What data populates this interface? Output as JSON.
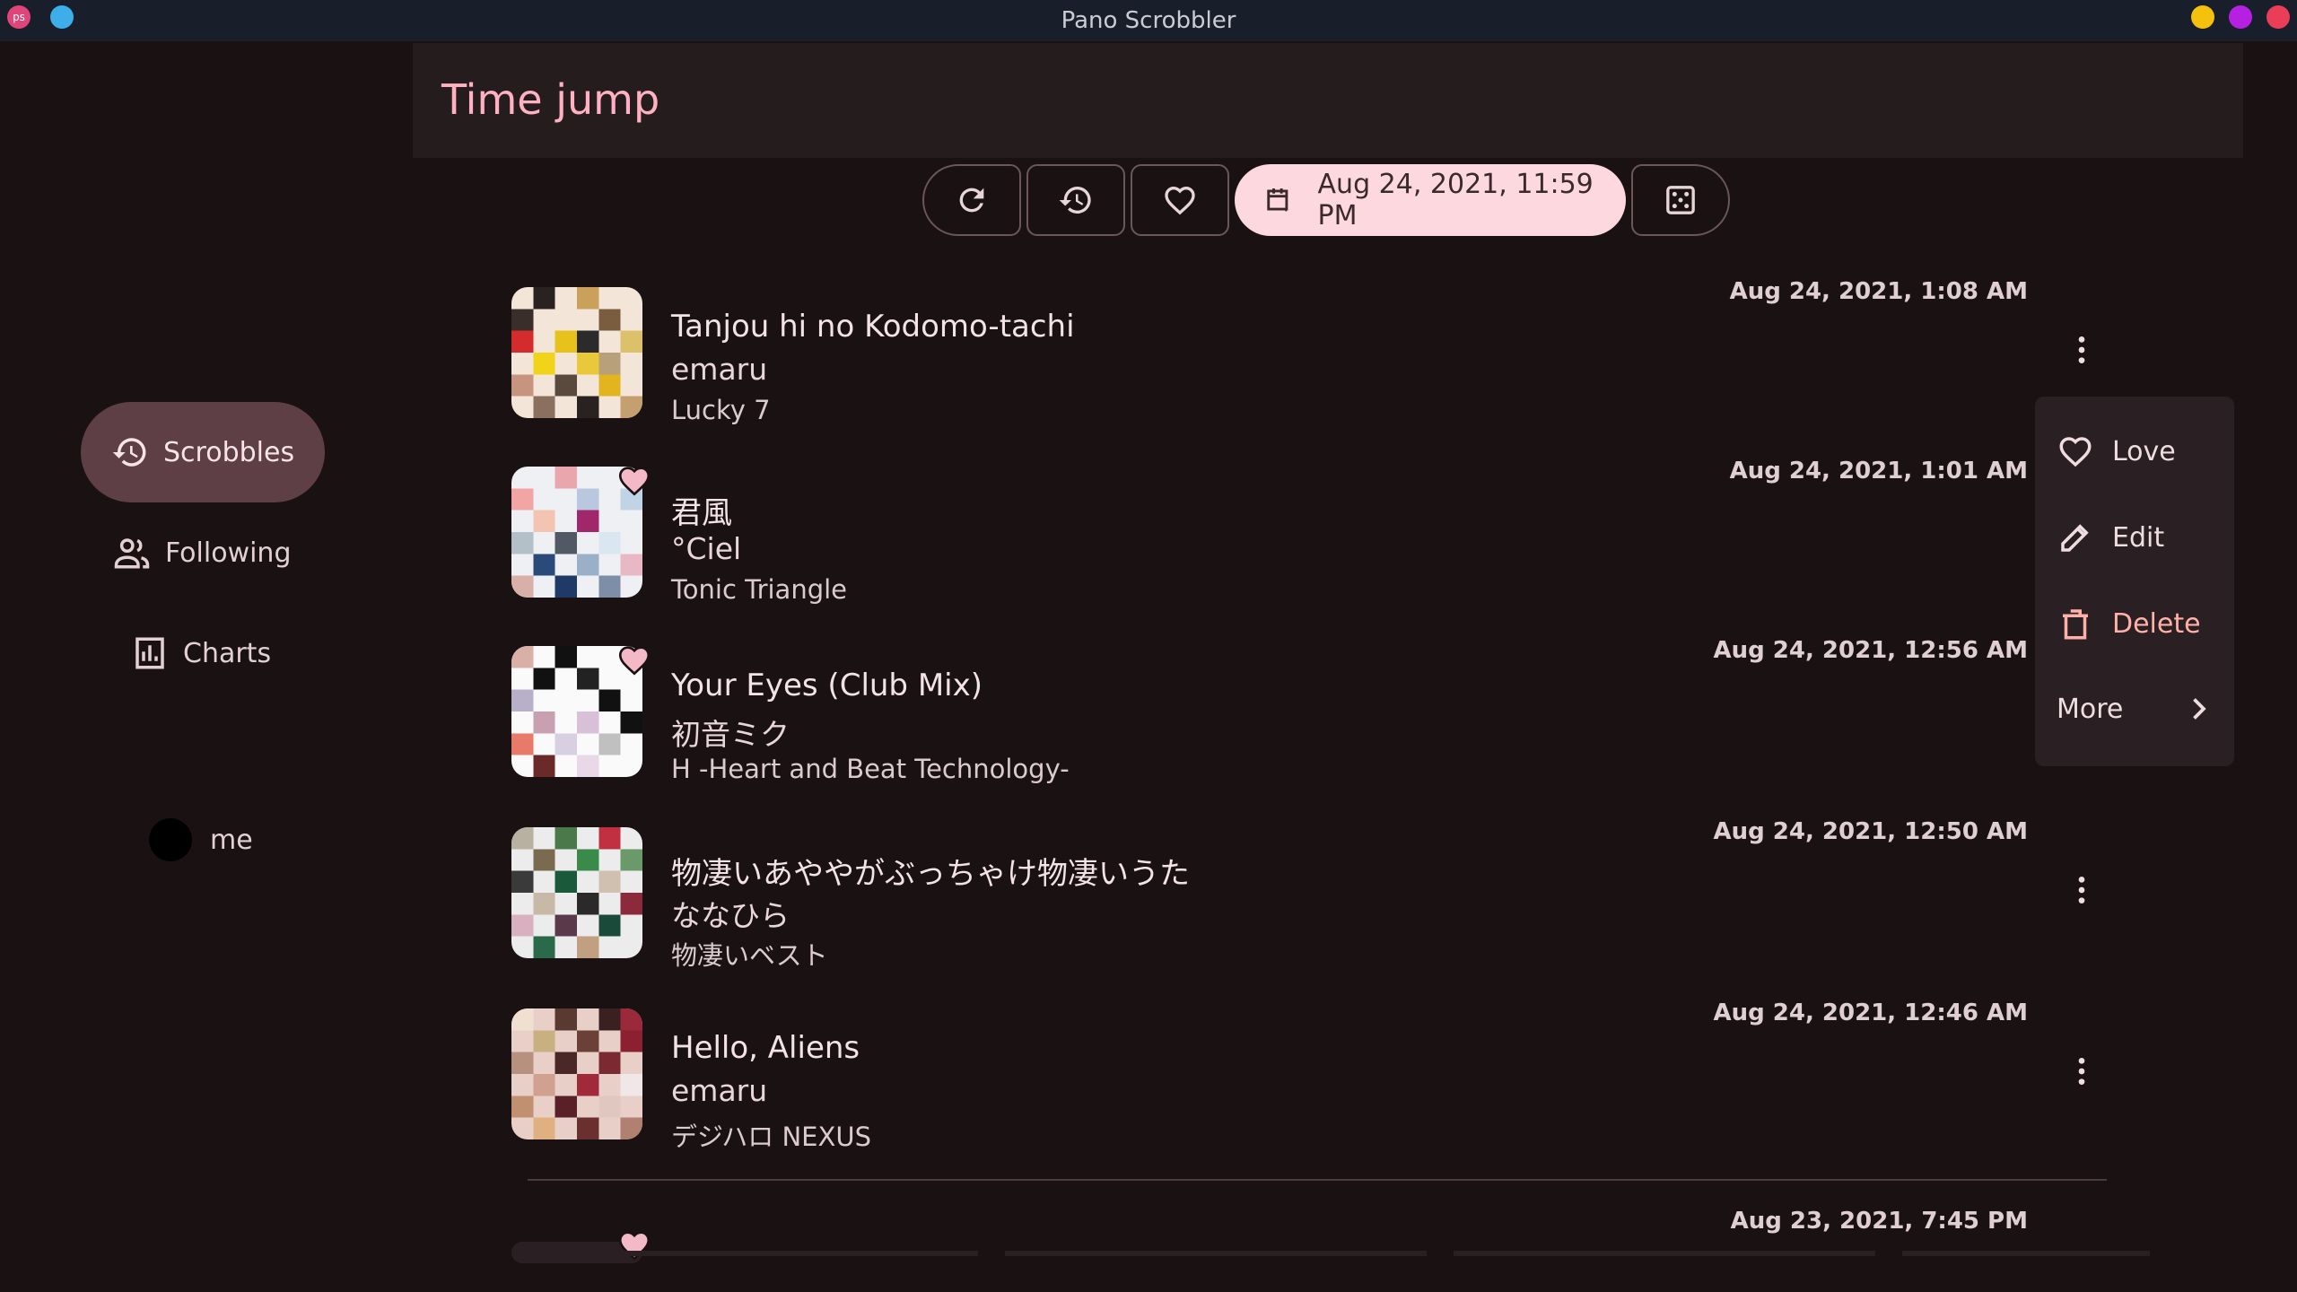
{
  "window": {
    "title": "Pano Scrobbler",
    "app_icon_text": "ps"
  },
  "header": {
    "title": "Time jump"
  },
  "nav": {
    "items": [
      {
        "label": "Scrobbles"
      },
      {
        "label": "Following"
      },
      {
        "label": "Charts"
      }
    ],
    "user": "me"
  },
  "toolbar": {
    "date_label": "Aug 24, 2021, 11:59 PM"
  },
  "tracks": [
    {
      "title": "Tanjou hi no Kodomo-tachi",
      "artist": "emaru",
      "album": "Lucky 7",
      "time": "Aug 24, 2021, 1:08 AM",
      "loved": false
    },
    {
      "title": "君風",
      "artist": "°Ciel",
      "album": "Tonic Triangle",
      "time": "Aug 24, 2021, 1:01 AM",
      "loved": true
    },
    {
      "title": "Your Eyes (Club Mix)",
      "artist": "初音ミク",
      "album": "H -Heart and Beat Technology-",
      "time": "Aug 24, 2021, 12:56 AM",
      "loved": true
    },
    {
      "title": "物凄いあややがぶっちゃけ物凄いうた",
      "artist": "ななひら",
      "album": "物凄いベスト",
      "time": "Aug 24, 2021, 12:50 AM",
      "loved": false
    },
    {
      "title": "Hello, Aliens",
      "artist": "emaru",
      "album": "デジハロ NEXUS",
      "time": "Aug 24, 2021, 12:46 AM",
      "loved": false
    },
    {
      "title": "",
      "artist": "",
      "album": "",
      "time": "Aug 23, 2021, 7:45 PM",
      "loved": true
    }
  ],
  "menu": {
    "love": "Love",
    "edit": "Edit",
    "delete": "Delete",
    "more": "More"
  },
  "colors": {
    "accent": "#ffb1c2",
    "nav_active": "#5d3f45",
    "date_chip": "#fed8df",
    "background": "#1a1113"
  }
}
